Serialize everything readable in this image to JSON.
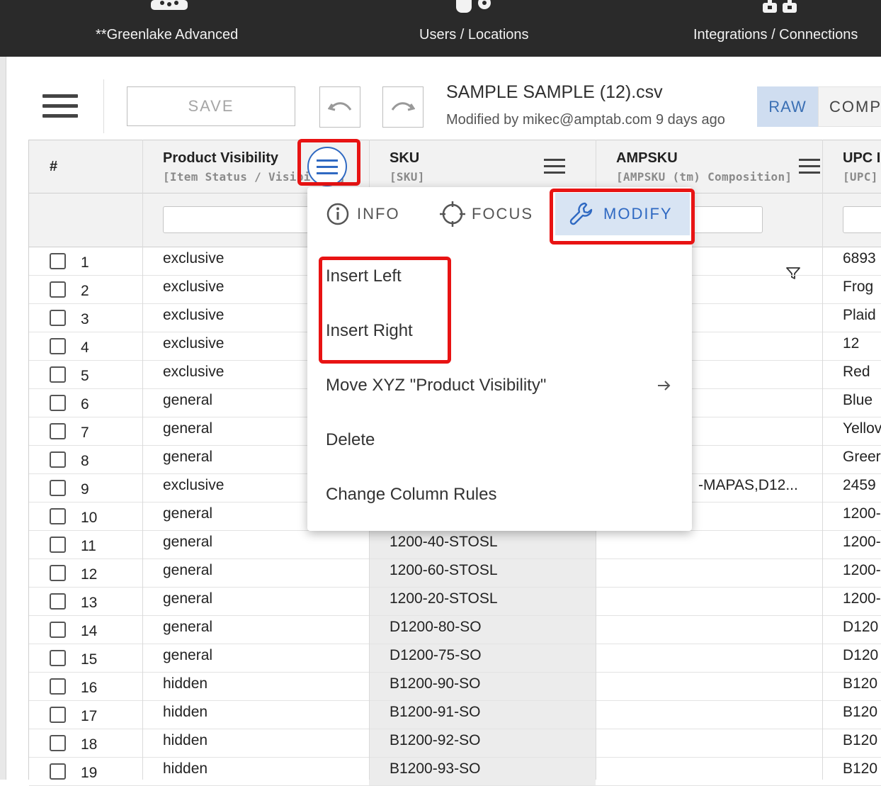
{
  "nav": {
    "items": [
      {
        "label": "**Greenlake Advanced"
      },
      {
        "label": "Users / Locations"
      },
      {
        "label": "Integrations / Connections"
      }
    ]
  },
  "toolbar": {
    "save_label": "SAVE",
    "file_title": "SAMPLE SAMPLE (12).csv",
    "file_subtitle": "Modified by mikec@amptab.com 9 days ago",
    "view_raw": "RAW",
    "view_comp": "COMP"
  },
  "grid": {
    "columns": {
      "index": "#",
      "visibility": {
        "title": "Product Visibility",
        "subtitle": "[Item Status / Visibility]"
      },
      "sku": {
        "title": "SKU",
        "subtitle": "[SKU]"
      },
      "ampsku": {
        "title": "AMPSKU",
        "subtitle": "[AMPSKU (tm) Composition]"
      },
      "upc": {
        "title": "UPC I",
        "subtitle": "[UPC]"
      }
    },
    "rows": [
      {
        "num": "1",
        "vis": "exclusive",
        "sku": "",
        "amp": "",
        "upc": "6893"
      },
      {
        "num": "2",
        "vis": "exclusive",
        "sku": "",
        "amp": "",
        "upc": "Frog"
      },
      {
        "num": "3",
        "vis": "exclusive",
        "sku": "",
        "amp": "",
        "upc": "Plaid"
      },
      {
        "num": "4",
        "vis": "exclusive",
        "sku": "",
        "amp": "",
        "upc": "12"
      },
      {
        "num": "5",
        "vis": "exclusive",
        "sku": "",
        "amp": "",
        "upc": "Red"
      },
      {
        "num": "6",
        "vis": "general",
        "sku": "",
        "amp": "",
        "upc": "Blue"
      },
      {
        "num": "7",
        "vis": "general",
        "sku": "",
        "amp": "",
        "upc": "Yellov"
      },
      {
        "num": "8",
        "vis": "general",
        "sku": "",
        "amp": "",
        "upc": "Greer"
      },
      {
        "num": "9",
        "vis": "exclusive",
        "sku": "",
        "amp": "-MAPAS,D12...",
        "upc": "2459"
      },
      {
        "num": "10",
        "vis": "general",
        "sku": "",
        "amp": "",
        "upc": "1200-"
      },
      {
        "num": "11",
        "vis": "general",
        "sku": "1200-40-STOSL",
        "amp": "",
        "upc": "1200-"
      },
      {
        "num": "12",
        "vis": "general",
        "sku": "1200-60-STOSL",
        "amp": "",
        "upc": "1200-"
      },
      {
        "num": "13",
        "vis": "general",
        "sku": "1200-20-STOSL",
        "amp": "",
        "upc": "1200-"
      },
      {
        "num": "14",
        "vis": "general",
        "sku": "D1200-80-SO",
        "amp": "",
        "upc": "D120"
      },
      {
        "num": "15",
        "vis": "general",
        "sku": "D1200-75-SO",
        "amp": "",
        "upc": "D120"
      },
      {
        "num": "16",
        "vis": "hidden",
        "sku": "B1200-90-SO",
        "amp": "",
        "upc": "B120"
      },
      {
        "num": "17",
        "vis": "hidden",
        "sku": "B1200-91-SO",
        "amp": "",
        "upc": "B120"
      },
      {
        "num": "18",
        "vis": "hidden",
        "sku": "B1200-92-SO",
        "amp": "",
        "upc": "B120"
      },
      {
        "num": "19",
        "vis": "hidden",
        "sku": "B1200-93-SO",
        "amp": "",
        "upc": "B120"
      }
    ]
  },
  "menu": {
    "tabs": {
      "info": "INFO",
      "focus": "FOCUS",
      "modify": "MODIFY"
    },
    "items": {
      "insert_left": "Insert Left",
      "insert_right": "Insert Right",
      "move": "Move XYZ \"Product Visibility\"",
      "delete": "Delete",
      "change_rules": "Change Column Rules"
    }
  },
  "colors": {
    "highlight": "#e81313",
    "accent": "#2f69c2",
    "topbar": "#2a2a2a"
  }
}
